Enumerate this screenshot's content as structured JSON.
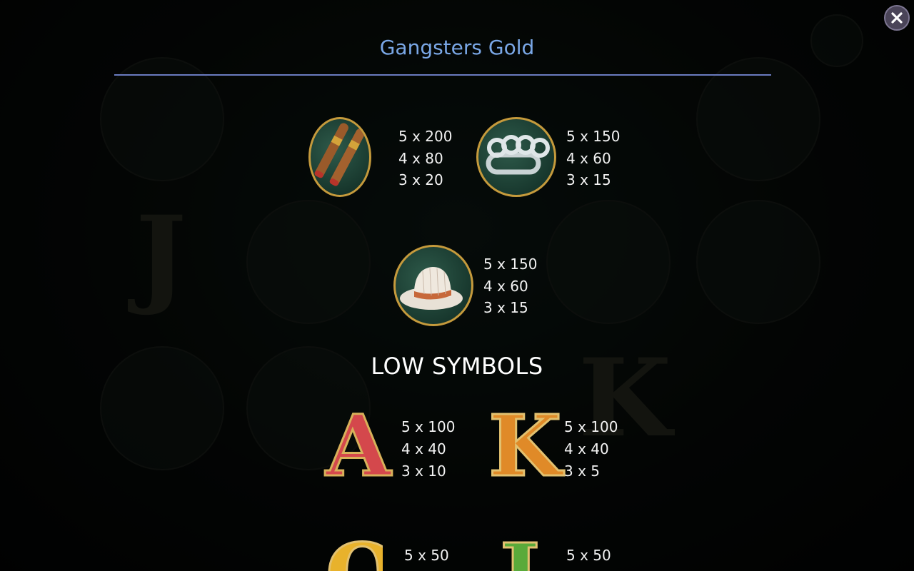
{
  "window": {
    "title": "Gangsters Gold"
  },
  "close": {
    "icon": "close-icon"
  },
  "high_symbols": [
    {
      "icon": "cigars-icon",
      "pays": [
        "5 x 200",
        "4 x 80",
        "3 x 20"
      ]
    },
    {
      "icon": "brass-knuckles-icon",
      "pays": [
        "5 x 150",
        "4 x 60",
        "3 x 15"
      ]
    },
    {
      "icon": "fedora-hat-icon",
      "pays": [
        "5 x 150",
        "4 x 60",
        "3 x 15"
      ]
    }
  ],
  "low_section": {
    "title": "LOW SYMBOLS"
  },
  "low_symbols": [
    {
      "icon": "letter-a-icon",
      "letter": "A",
      "pays": [
        "5 x 100",
        "4 x 40",
        "3 x 10"
      ]
    },
    {
      "icon": "letter-k-icon",
      "letter": "K",
      "pays": [
        "5 x 100",
        "4 x 40",
        "3 x 5"
      ]
    },
    {
      "icon": "letter-q-icon",
      "letter": "Q",
      "pays": [
        "5 x 50"
      ]
    },
    {
      "icon": "letter-j-icon",
      "letter": "J",
      "pays": [
        "5 x 50"
      ]
    }
  ],
  "colors": {
    "title": "#7aa7e6",
    "divider": "#6a7bc0",
    "gold": "#c59a3c"
  }
}
